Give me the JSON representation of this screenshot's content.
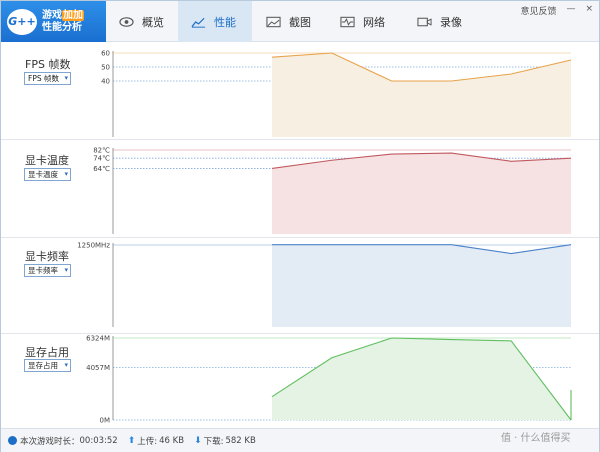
{
  "app": {
    "logo_badge": "G++",
    "logo_line1": "游戏",
    "logo_line1_hl": "加加",
    "logo_line2": "性能分析"
  },
  "tabs": [
    {
      "label": "概览",
      "icon": "eye-icon"
    },
    {
      "label": "性能",
      "icon": "chart-icon"
    },
    {
      "label": "截图",
      "icon": "image-icon"
    },
    {
      "label": "网络",
      "icon": "pulse-icon"
    },
    {
      "label": "录像",
      "icon": "video-icon"
    }
  ],
  "header_right": {
    "feedback": "意见反馈",
    "minimize": "—",
    "close": "×"
  },
  "panels": [
    {
      "title": "FPS 帧数",
      "select": "FPS 帧数"
    },
    {
      "title": "显卡温度",
      "select": "显卡温度"
    },
    {
      "title": "显卡频率",
      "select": "显卡频率"
    },
    {
      "title": "显存占用",
      "select": "显存占用"
    }
  ],
  "chart_data": [
    {
      "type": "area",
      "title": "FPS 帧数",
      "yticks": [
        "60",
        "50",
        "40"
      ],
      "yvalues": [
        60,
        50,
        40
      ],
      "ylim": [
        0,
        60
      ],
      "x": [
        0,
        1,
        2,
        3,
        4,
        5
      ],
      "values": [
        57,
        60,
        40,
        40,
        45,
        55
      ],
      "color": "#e8a24a",
      "fill": "#f7efe2"
    },
    {
      "type": "area",
      "title": "显卡温度",
      "yticks": [
        "82℃",
        "74℃",
        "64℃"
      ],
      "yvalues": [
        82,
        74,
        64
      ],
      "ylim": [
        0,
        82
      ],
      "x": [
        0,
        1,
        2,
        3,
        4,
        5
      ],
      "values": [
        64,
        72,
        78,
        79,
        71,
        74
      ],
      "color": "#c0595f",
      "fill": "#f6e1e3"
    },
    {
      "type": "area",
      "title": "显卡频率",
      "yticks": [
        "1250MHz"
      ],
      "yvalues": [
        1250
      ],
      "ylim": [
        0,
        1250
      ],
      "x": [
        0,
        1,
        2,
        3,
        4,
        5
      ],
      "values": [
        1255,
        1255,
        1255,
        1255,
        1120,
        1255
      ],
      "color": "#4a82c8",
      "fill": "#e3ebf5"
    },
    {
      "type": "area",
      "title": "显存占用",
      "yticks": [
        "6324M",
        "4057M",
        "0M"
      ],
      "yvalues": [
        6324,
        4057,
        0
      ],
      "ylim": [
        0,
        6324
      ],
      "x": [
        0,
        1,
        2,
        3,
        4,
        5
      ],
      "values": [
        1800,
        4800,
        6324,
        6200,
        6100,
        0
      ],
      "color": "#5fbf5f",
      "fill": "#e5f3e5"
    }
  ],
  "footer": {
    "session_label": "本次游戏时长：",
    "session_time": "00:03:52",
    "upload_label": "上传:",
    "upload_value": "46 KB",
    "download_label": "下载:",
    "download_value": "582 KB",
    "watermark": "值 · 什么值得买"
  },
  "colors": {
    "accent": "#1c6fc7",
    "logo_bg": "#1a6fd0"
  }
}
